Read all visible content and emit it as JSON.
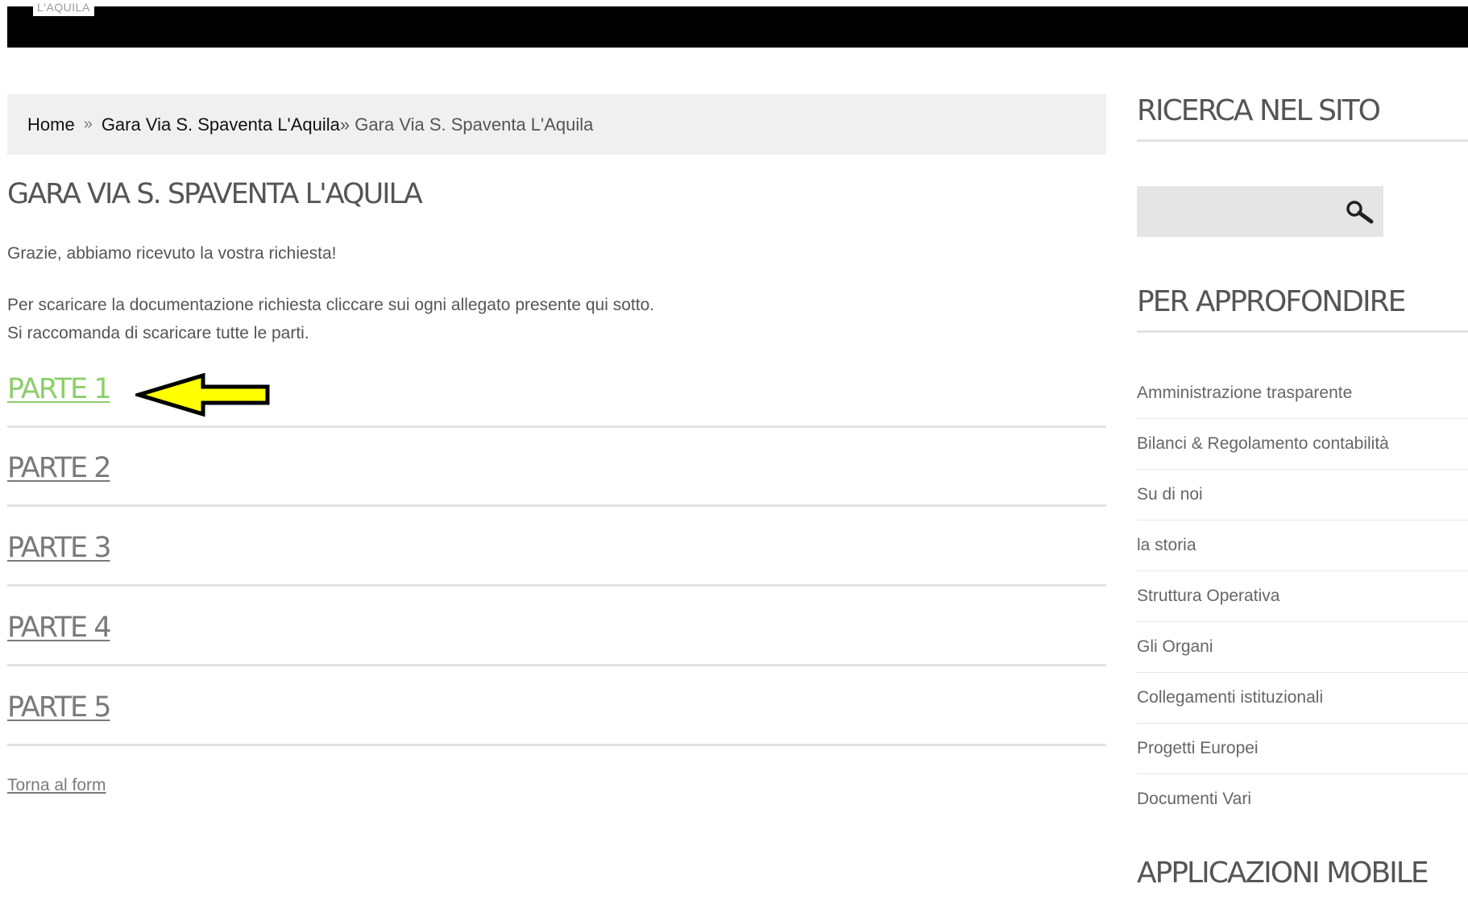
{
  "header": {
    "logo_text": "L'AQUILA"
  },
  "breadcrumb": {
    "home": "Home",
    "separator": "»",
    "parent": "Gara Via S. Spaventa L'Aquila",
    "current_prefix": "»",
    "current": "Gara Via S. Spaventa L'Aquila"
  },
  "main": {
    "title": "GARA VIA S. SPAVENTA L'AQUILA",
    "thanks": "Grazie, abbiamo ricevuto la vostra richiesta!",
    "instructions_line1": "Per scaricare la documentazione richiesta cliccare sui ogni allegato presente qui sotto.",
    "instructions_line2": "Si raccomanda di scaricare tutte le parti.",
    "parts": [
      "PARTE 1",
      "PARTE 2",
      "PARTE 3",
      "PARTE 4",
      "PARTE 5"
    ],
    "back_link": "Torna al form"
  },
  "sidebar": {
    "search_title": "RICERCA NEL SITO",
    "search_placeholder": "",
    "more_title": "PER APPROFONDIRE",
    "links": [
      "Amministrazione trasparente",
      "Bilanci & Regolamento contabilità",
      "Su di noi",
      "la storia",
      "Struttura Operativa",
      "Gli Organi",
      "Collegamenti istituzionali",
      "Progetti Europei",
      "Documenti Vari"
    ],
    "apps_title": "APPLICAZIONI MOBILE"
  },
  "colors": {
    "highlight_link": "#8dcf6b",
    "arrow_fill": "#ffff00",
    "top_bar": "#000000"
  }
}
